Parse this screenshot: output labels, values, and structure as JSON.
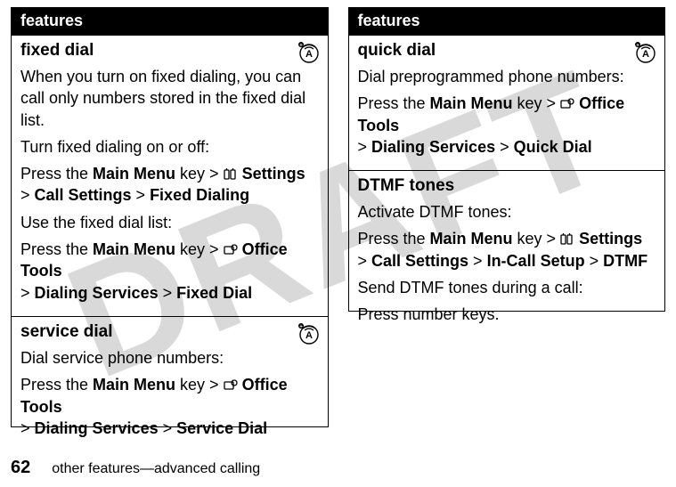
{
  "watermark": "DRAFT",
  "left": {
    "header": "features",
    "rows": [
      {
        "title": "fixed dial",
        "p1": "When you turn on fixed dialing, you can call only numbers stored in the fixed dial list.",
        "p2": "Turn fixed dialing on or off:",
        "p3a": "Press the ",
        "p3b": "Main Menu",
        "p3c": " key > ",
        "p3d": "Settings",
        "p3e": "> ",
        "p3f": "Call Settings",
        "p3g": " > ",
        "p3h": "Fixed Dialing",
        "p4": "Use the fixed dial list:",
        "p5a": "Press the ",
        "p5b": "Main Menu",
        "p5c": " key > ",
        "p5d": "Office Tools",
        "p5e": "> ",
        "p5f": "Dialing Services",
        "p5g": " > ",
        "p5h": "Fixed Dial",
        "badge": true
      },
      {
        "title": "service dial",
        "p1": "Dial service phone numbers:",
        "p2a": "Press the ",
        "p2b": "Main Menu",
        "p2c": " key > ",
        "p2d": "Office Tools",
        "p2e": "> ",
        "p2f": "Dialing Services",
        "p2g": " > ",
        "p2h": "Service Dial",
        "badge": true
      }
    ]
  },
  "right": {
    "header": "features",
    "rows": [
      {
        "title": "quick dial",
        "p1": "Dial preprogrammed phone numbers:",
        "p2a": "Press the ",
        "p2b": "Main Menu",
        "p2c": " key > ",
        "p2d": "Office Tools",
        "p2e": "> ",
        "p2f": "Dialing Services",
        "p2g": " > ",
        "p2h": "Quick Dial",
        "badge": true
      },
      {
        "title": "DTMF tones",
        "p1": "Activate DTMF tones:",
        "p2a": "Press the ",
        "p2b": "Main Menu",
        "p2c": " key > ",
        "p2d": "Settings",
        "p2e": "> ",
        "p2f": "Call Settings",
        "p2g": " > ",
        "p2h": "In-Call Setup",
        "p2i": " > ",
        "p2j": "DTMF",
        "p3": "Send DTMF tones during a call:",
        "p4": "Press number keys.",
        "badge": false
      }
    ]
  },
  "footer": {
    "page": "62",
    "text": "other features—advanced calling"
  }
}
